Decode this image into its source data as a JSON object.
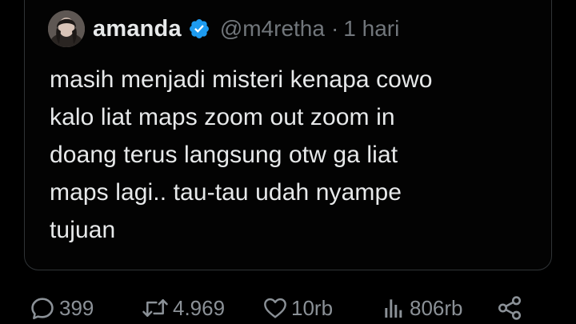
{
  "tweet": {
    "display_name": "amanda",
    "handle": "@m4retha",
    "separator": "·",
    "time": "1 hari",
    "text": "masih menjadi misteri kenapa cowo\nkalo liat maps zoom out zoom in\ndoang terus langsung otw ga liat\nmaps lagi.. tau-tau udah nyampe\ntujuan",
    "verified": true
  },
  "metrics": {
    "replies": "399",
    "retweets": "4.969",
    "likes": "10rb",
    "views": "806rb"
  },
  "icons": {
    "reply": "reply-icon",
    "retweet": "retweet-icon",
    "like": "like-icon",
    "views": "views-icon",
    "share": "share-icon",
    "verified": "verified-badge-icon"
  },
  "colors": {
    "background": "#000000",
    "text": "#e7e9ea",
    "muted": "#71767b",
    "verified": "#1d9bf0",
    "card_border": "#2f3336"
  }
}
